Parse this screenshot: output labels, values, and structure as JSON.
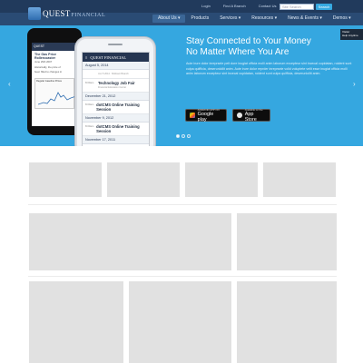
{
  "header": {
    "logo_main": "QUEST",
    "logo_sub": "FINANCIAL",
    "util_links": [
      "Login",
      "Find A Branch",
      "Contact Us"
    ],
    "search_placeholder": "Site Search",
    "search_button": "Search"
  },
  "nav": {
    "items": [
      {
        "label": "About Us ▾",
        "active": true
      },
      {
        "label": "Products",
        "active": false
      },
      {
        "label": "Services ▾",
        "active": false
      },
      {
        "label": "Resources ▾",
        "active": false
      },
      {
        "label": "News & Events ▾",
        "active": false
      },
      {
        "label": "Demos ▾",
        "active": false
      }
    ]
  },
  "hero": {
    "title_line1": "Stay Connected to Your Money",
    "title_line2": "No Matter Where You Are",
    "body": "Aute irure dolor inreprsele pelt dore inugiat officia molli anim laborum excepteur sint incecal cupidatan, roident sunt culpa quifficia, deserunlollit anim. Aute irure dolor reprder inreprsele volid voluptete velit esse inugiat officia molli anim laborum excepteur sint incecal cupidatan, roident sunt culpa quifficia, deserunlollit anim.",
    "google_small": "ANDROID APP ON",
    "google_big": "Google play",
    "apple_small": "Available on the",
    "apple_big": "App Store",
    "chat_line1": "Visitor",
    "chat_line2": "Help  Anytime",
    "arrow_left": "‹",
    "arrow_right": "›"
  },
  "phone_back": {
    "header": "QUEST",
    "title": "The Gas Price Rollercoaster",
    "date": "June 29th 2007",
    "text1": "Historically, the price of",
    "text2": "been filled to changes in",
    "chart_title": "Regular Gasoline Prices"
  },
  "phone_front": {
    "brand": "QUEST FINANCIAL",
    "date1": "August 5, 2014",
    "events": [
      {
        "time": "",
        "title": "",
        "sub": "Jun 5 2014 · Midtown Branch"
      },
      {
        "time": "8:00am",
        "title": "Technology Job Fair",
        "sub": "Financial Education Center"
      }
    ],
    "date2": "December 21, 2012",
    "events2": [
      {
        "time": "8:00am",
        "title": "dotCMS Online Training Session",
        "sub": ""
      }
    ],
    "date3": "November 9, 2012",
    "events3": [
      {
        "time": "8:00am",
        "title": "dotCMS Online Training Session",
        "sub": ""
      }
    ],
    "date4": "November 17, 2011"
  }
}
